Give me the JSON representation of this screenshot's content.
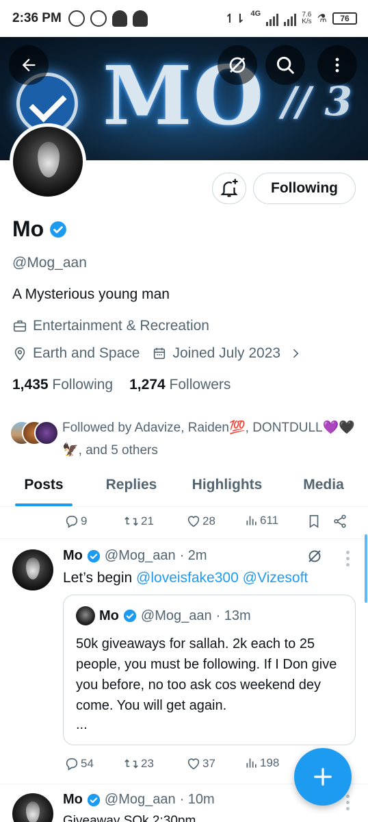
{
  "status_bar": {
    "time": "2:36 PM",
    "network": "4G",
    "speed_value": "7.6",
    "speed_unit": "K/s",
    "battery": "76"
  },
  "banner": {
    "text": "MO",
    "extra": "// 3"
  },
  "profile": {
    "name": "Mo",
    "handle": "@Mog_aan",
    "bio": "A Mysterious young man",
    "category": "Entertainment & Recreation",
    "location": "Earth and Space",
    "joined": "Joined July 2023",
    "following_count": "1,435",
    "following_label": "Following",
    "followers_count": "1,274",
    "followers_label": "Followers",
    "follow_button": "Following",
    "followed_by": "Followed by Adavize, Raiden💯, DONTDULL💜🖤🦅, and 5 others"
  },
  "tabs": [
    {
      "label": "Posts",
      "active": true
    },
    {
      "label": "Replies",
      "active": false
    },
    {
      "label": "Highlights",
      "active": false
    },
    {
      "label": "Media",
      "active": false
    }
  ],
  "prev_post_stats": {
    "replies": "9",
    "reposts": "21",
    "likes": "28",
    "views": "611"
  },
  "post": {
    "name": "Mo",
    "handle": "@Mog_aan",
    "time": "· 2m",
    "text_prefix": "Let’s begin ",
    "mention1": "@loveisfake300",
    "mention2": "@Vizesoft",
    "quote": {
      "name": "Mo",
      "handle": "@Mog_aan",
      "time": "· 13m",
      "text": "50k giveaways for sallah. 2k each to 25 people, you must be following. If I Don give you before, no too ask cos weekend dey come. You will get again.",
      "more": "..."
    },
    "stats": {
      "replies": "54",
      "reposts": "23",
      "likes": "37",
      "views": "198"
    }
  },
  "next_post": {
    "name": "Mo",
    "handle": "@Mog_aan",
    "time": "· 10m",
    "text": "Giveaway SOk 2:30pm"
  },
  "colors": {
    "accent": "#1d9bf0",
    "text": "#0f1419",
    "muted": "#536471",
    "border": "#cfd9de"
  }
}
